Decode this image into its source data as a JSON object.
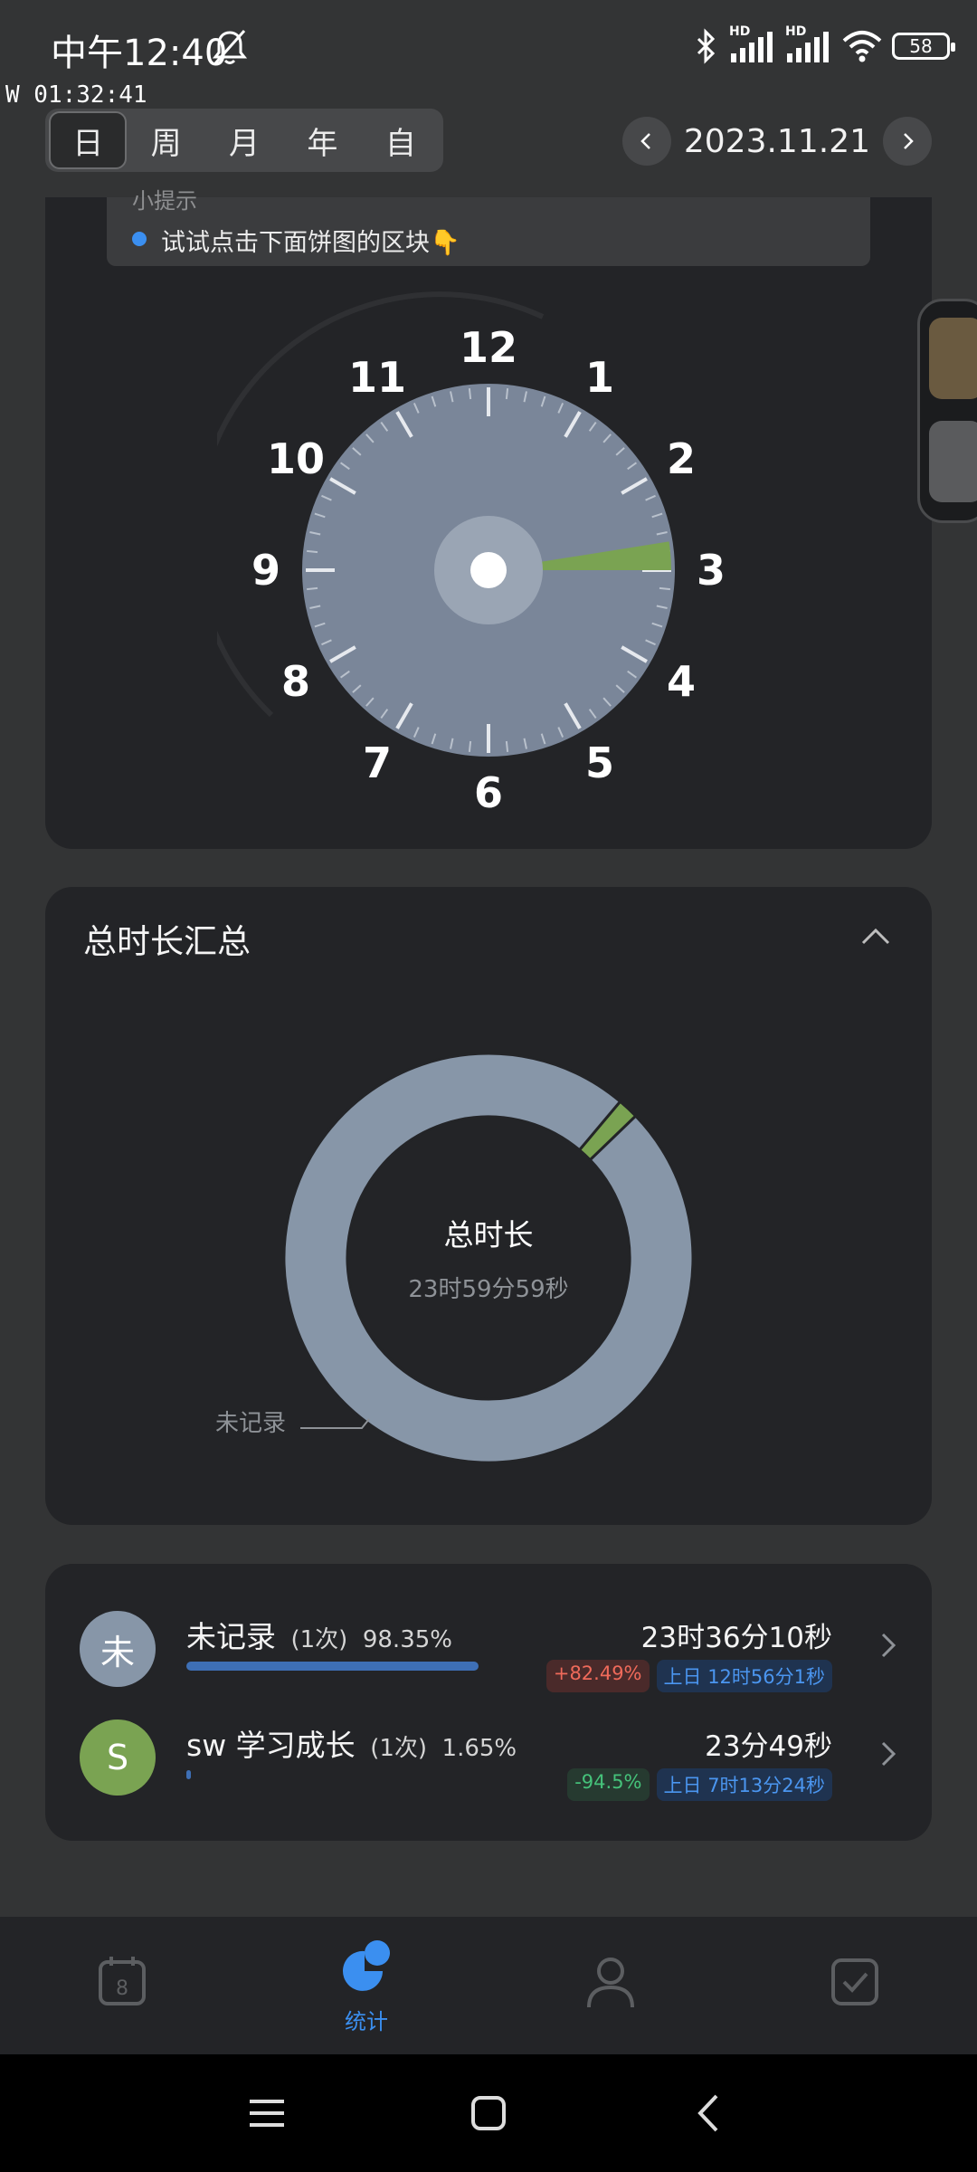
{
  "status_bar": {
    "time": "中午12:40",
    "battery": "58",
    "network_tag_1": "HD",
    "network_tag_2": "HD"
  },
  "overlay_timer": "W 01:32:41",
  "period_tabs": [
    "日",
    "周",
    "月",
    "年",
    "自"
  ],
  "active_period_index": 0,
  "date": "2023.11.21",
  "tip": {
    "title": "小提示",
    "text": "试试点击下面饼图的区块👇"
  },
  "clock": {
    "numbers": [
      "12",
      "1",
      "2",
      "3",
      "4",
      "5",
      "6",
      "7",
      "8",
      "9",
      "10",
      "11"
    ],
    "face_color": "#7a8699",
    "slice_color": "#7aa352",
    "slice_start_hour": 2.7,
    "slice_end_hour": 3.0
  },
  "summary": {
    "title": "总时长汇总",
    "donut_title": "总时长",
    "donut_subtitle": "23时59分59秒",
    "callout_label": "未记录"
  },
  "chart_data": {
    "type": "pie",
    "title": "总时长",
    "slices": [
      {
        "label": "未记录",
        "percent": 98.35,
        "color": "#8796a8"
      },
      {
        "label": "sw 学习成长",
        "percent": 1.65,
        "color": "#7aa352"
      }
    ]
  },
  "records": [
    {
      "avatar": "未",
      "avatar_color": "#8796a8",
      "name": "未记录",
      "count": "(1次)",
      "percent": "98.35%",
      "bar_fraction": 0.98,
      "duration": "23时36分10秒",
      "change": "+82.49%",
      "change_color": "red",
      "previous": "上日 12时56分1秒"
    },
    {
      "avatar": "S",
      "avatar_color": "#7aa352",
      "name": "sw 学习成长",
      "count": "(1次)",
      "percent": "1.65%",
      "bar_fraction": 0.0165,
      "duration": "23分49秒",
      "change": "-94.5%",
      "change_color": "green",
      "previous": "上日 7时13分24秒"
    }
  ],
  "bottom_nav": {
    "calendar_day": "8",
    "stats_label": "统计",
    "active_index": 1
  }
}
